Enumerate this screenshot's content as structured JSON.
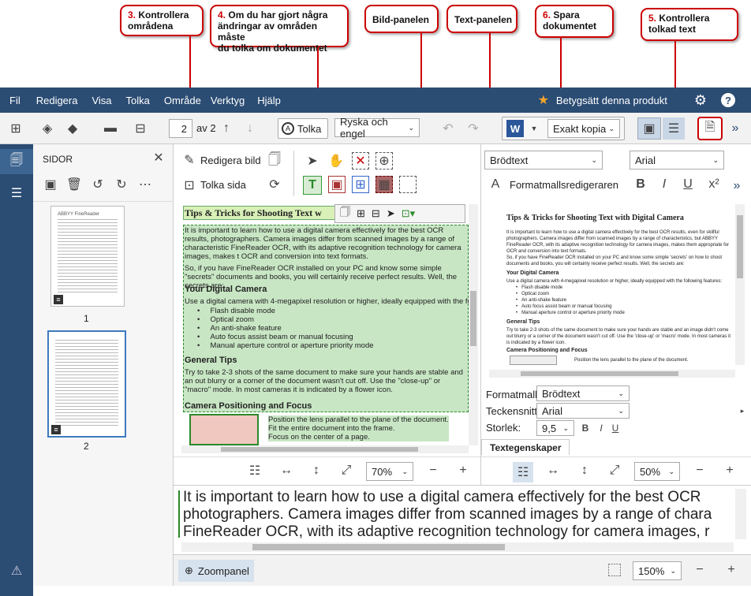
{
  "callouts": {
    "c3": {
      "num": "3.",
      "text": "Kontrollera\nområdena"
    },
    "c4": {
      "num": "4.",
      "text": "Om du har gjort några\nändringar av områden måste\ndu tolka om dokumentet"
    },
    "bild": {
      "num": "",
      "text": "Bild-panelen"
    },
    "text": {
      "num": "",
      "text": "Text-panelen"
    },
    "c6": {
      "num": "6.",
      "text": "Spara\ndokumentet"
    },
    "c5": {
      "num": "5.",
      "text": "Kontrollera\ntolkad text"
    }
  },
  "menu": [
    "Fil",
    "Redigera",
    "Visa",
    "Tolka",
    "Område",
    "Verktyg",
    "Hjälp"
  ],
  "rate": "Betygsätt denna produkt",
  "toolbar": {
    "page_value": "2",
    "page_of": "av 2",
    "tolka": "Tolka",
    "language": "Ryska och engel",
    "format": "Exakt kopia"
  },
  "pages_panel": {
    "title": "SIDOR",
    "page1": "1",
    "page2": "2"
  },
  "image_tools": {
    "edit": "Redigera bild",
    "recognize": "Tolka sida"
  },
  "text_tools": {
    "style": "Brödtext",
    "font": "Arial",
    "style_editor": "Formatmallsredigeraren"
  },
  "document": {
    "title": "Tips & Tricks for Shooting Text w",
    "p1": "It is important to learn how to use a digital camera effectively for the best OCR results, photographers. Camera images differ from scanned images by a range of characteristic FineReader OCR, with its adaptive recognition technology for camera images, makes t OCR and conversion into text formats.",
    "p2": "So, if you have FineReader OCR installed on your PC and know some simple \"secrets\" documents and books, you will certainly receive perfect results. Well, the secrets are:",
    "h1": "Your Digital Camera",
    "p3": "Use a digital camera with 4-megapixel resolution or higher, ideally equipped with the fo",
    "bullets": [
      "Flash disable mode",
      "Optical zoom",
      "An anti-shake feature",
      "Auto focus assist beam or manual focusing",
      "Manual aperture control or aperture priority mode"
    ],
    "h2": "General Tips",
    "p4": "Try to take 2-3 shots of the same document to make sure your hands are stable and an out blurry or a corner of the document wasn't cut off. Use the \"close-up\" or \"macro\" mode. In most cameras it is indicated by a flower icon.",
    "h3": "Camera Positioning and Focus",
    "b2": [
      "Position the lens parallel to the plane of the document.",
      "Fit the entire document into the frame.",
      "Focus on the center of a page."
    ]
  },
  "text_doc": {
    "title": "Tips & Tricks for Shooting Text with Digital Camera",
    "p1": "It is important to learn how to use a digital camera effectively for the best OCR results, even for skillful photographers. Camera images differ from scanned images by a range of characteristics, but ABBYY FineReader OCR, with its adaptive recognition technology for camera images, makes them appropriate for OCR and conversion into text formats.",
    "p2": "So, if you have FineReader OCR installed on your PC and know some simple 'secrets' on how to shoot documents and books, you will certainly receive perfect results. Well, the secrets are:",
    "h1": "Your Digital Camera",
    "p3": "Use a digital camera with 4-megapixel resolution or higher, ideally equipped with the following features:",
    "bullets": [
      "Flash disable mode",
      "Optical zoom",
      "An anti-shake feature",
      "Auto focus assist beam or manual focusing",
      "Manual aperture control or aperture priority mode"
    ],
    "h2": "General Tips",
    "p4": "Try to take 2-3 shots of the same document to make sure your hands are stable and an image didn't come out blurry or a corner of the document wasn't cut off. Use the 'close-up' or 'macro' mode. In most cameras it is indicated by a flower icon.",
    "h3": "Camera Positioning and Focus",
    "b1": "Position the lens parallel to the plane of the document."
  },
  "props": {
    "formatmall_label": "Formatmall:",
    "formatmall": "Brödtext",
    "font_label": "Teckensnitt:",
    "font": "Arial",
    "size_label": "Storlek:",
    "size": "9,5",
    "tab": "Textegenskaper"
  },
  "zoom": {
    "image": "70%",
    "text": "50%",
    "zoompanel": "150%",
    "zoompanel_label": "Zoompanel"
  },
  "zoom_text": {
    "l1": "It is important to learn how to use a digital camera effectively for the best OCR",
    "l2": "photographers. Camera images differ from scanned images by a range of chara",
    "l3": "FineReader OCR, with its adaptive recognition technology for camera images, r"
  },
  "thumb_tiny": "ABBYY FineReader"
}
